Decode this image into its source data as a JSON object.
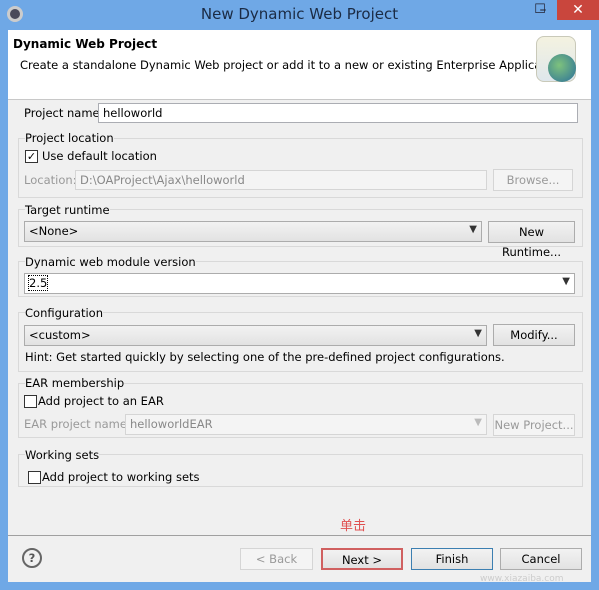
{
  "window": {
    "title": "New Dynamic Web Project",
    "minimize": "–",
    "maximize": "☐",
    "close": "✕"
  },
  "header": {
    "title": "Dynamic Web Project",
    "description": "Create a standalone Dynamic Web project or add it to a new or existing Enterprise Application."
  },
  "project_name": {
    "label": "Project name:",
    "value": "helloworld"
  },
  "project_location": {
    "group": "Project location",
    "use_default": "Use default location",
    "use_default_checked": true,
    "location_label": "Location:",
    "location_value": "D:\\OAProject\\Ajax\\helloworld",
    "browse": "Browse..."
  },
  "target_runtime": {
    "group": "Target runtime",
    "value": "<None>",
    "new_runtime": "New Runtime..."
  },
  "module_version": {
    "group": "Dynamic web module version",
    "value": "2.5"
  },
  "configuration": {
    "group": "Configuration",
    "value": "<custom>",
    "modify": "Modify...",
    "hint": "Hint: Get started quickly by selecting one of the pre-defined project configurations."
  },
  "ear": {
    "group": "EAR membership",
    "add": "Add project to an EAR",
    "add_checked": false,
    "name_label": "EAR project name:",
    "name_value": "helloworldEAR",
    "new_project": "New Project..."
  },
  "working_sets": {
    "group": "Working sets",
    "add": "Add project to working sets",
    "add_checked": false
  },
  "annotation": "单击",
  "footer": {
    "help": "?",
    "back": "< Back",
    "next": "Next >",
    "finish": "Finish",
    "cancel": "Cancel"
  },
  "watermark": "www.xiazaiba.com",
  "colors": {
    "annotation": "#e05050",
    "titlebar": "#6fa8e6",
    "close": "#c9463d"
  }
}
